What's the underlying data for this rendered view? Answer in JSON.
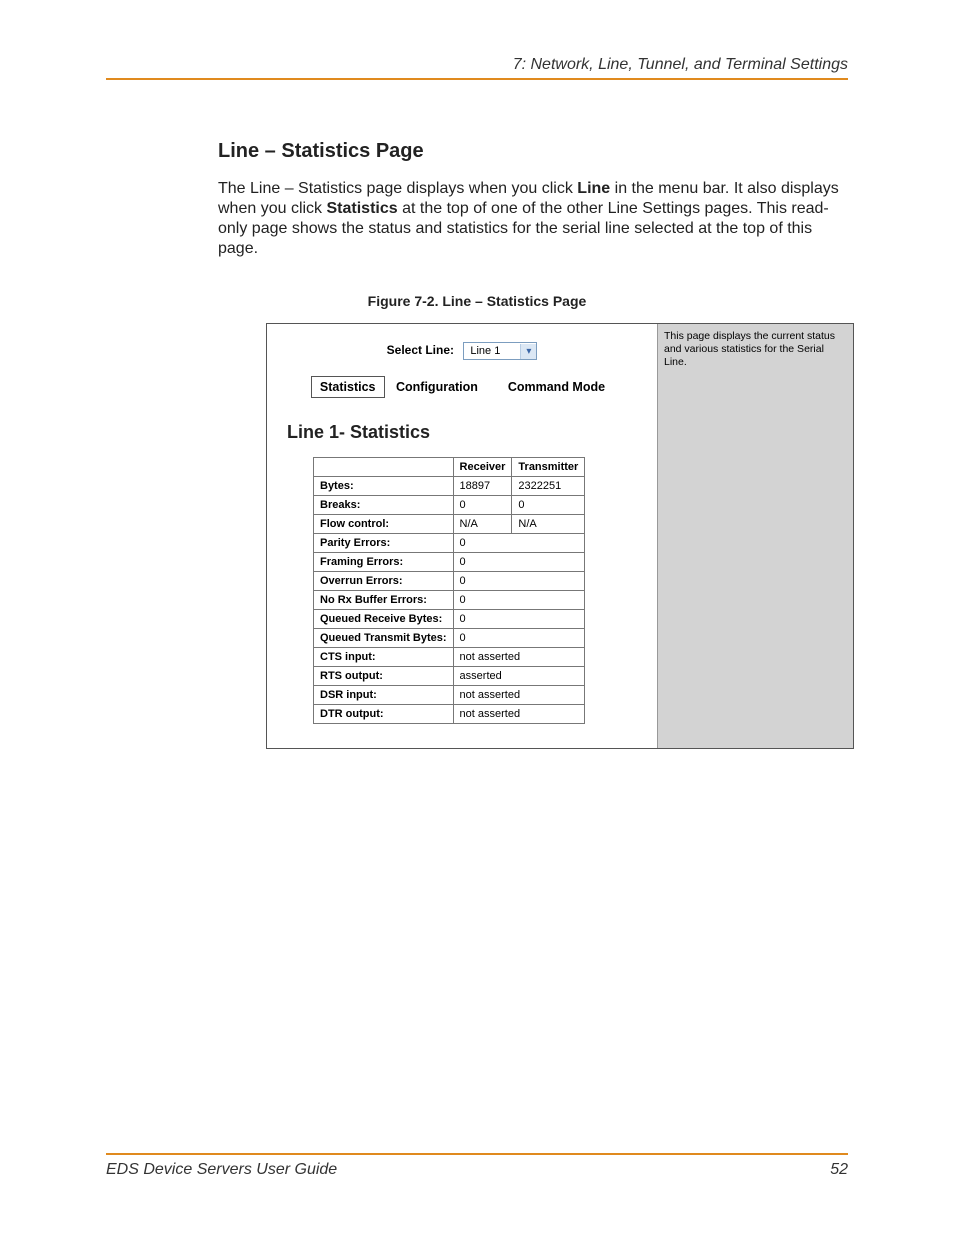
{
  "header": {
    "chapter": "7: Network, Line, Tunnel, and Terminal Settings"
  },
  "section": {
    "title": "Line – Statistics Page",
    "para_prefix": "The Line – Statistics page displays when you click ",
    "bold1": "Line",
    "para_mid1": " in the menu bar. It also displays when you click ",
    "bold2": "Statistics",
    "para_suffix": " at the top of one of the other Line Settings pages. This read-only page shows the status and statistics for the serial line selected at the top of this page."
  },
  "figure": {
    "caption": "Figure 7-2. Line – Statistics Page",
    "side_text": "This page displays the current status and various statistics for the Serial Line.",
    "select_label": "Select Line:",
    "select_value": "Line 1",
    "tabs": {
      "statistics": "Statistics",
      "configuration": "Configuration",
      "command_mode": "Command Mode"
    },
    "panel_heading": "Line 1- Statistics",
    "col_receiver": "Receiver",
    "col_transmitter": "Transmitter",
    "rows_two": [
      {
        "label": "Bytes:",
        "rx": "18897",
        "tx": "2322251"
      },
      {
        "label": "Breaks:",
        "rx": "0",
        "tx": "0"
      },
      {
        "label": "Flow control:",
        "rx": "N/A",
        "tx": "N/A"
      }
    ],
    "rows_one": [
      {
        "label": "Parity Errors:",
        "val": "0"
      },
      {
        "label": "Framing Errors:",
        "val": "0"
      },
      {
        "label": "Overrun Errors:",
        "val": "0"
      },
      {
        "label": "No Rx Buffer Errors:",
        "val": "0"
      },
      {
        "label": "Queued Receive Bytes:",
        "val": "0"
      },
      {
        "label": "Queued Transmit Bytes:",
        "val": "0"
      },
      {
        "label": "CTS input:",
        "val": "not asserted"
      },
      {
        "label": "RTS output:",
        "val": "asserted"
      },
      {
        "label": "DSR input:",
        "val": "not asserted"
      },
      {
        "label": "DTR output:",
        "val": "not asserted"
      }
    ]
  },
  "footer": {
    "guide": "EDS Device Servers User Guide",
    "page": "52"
  }
}
